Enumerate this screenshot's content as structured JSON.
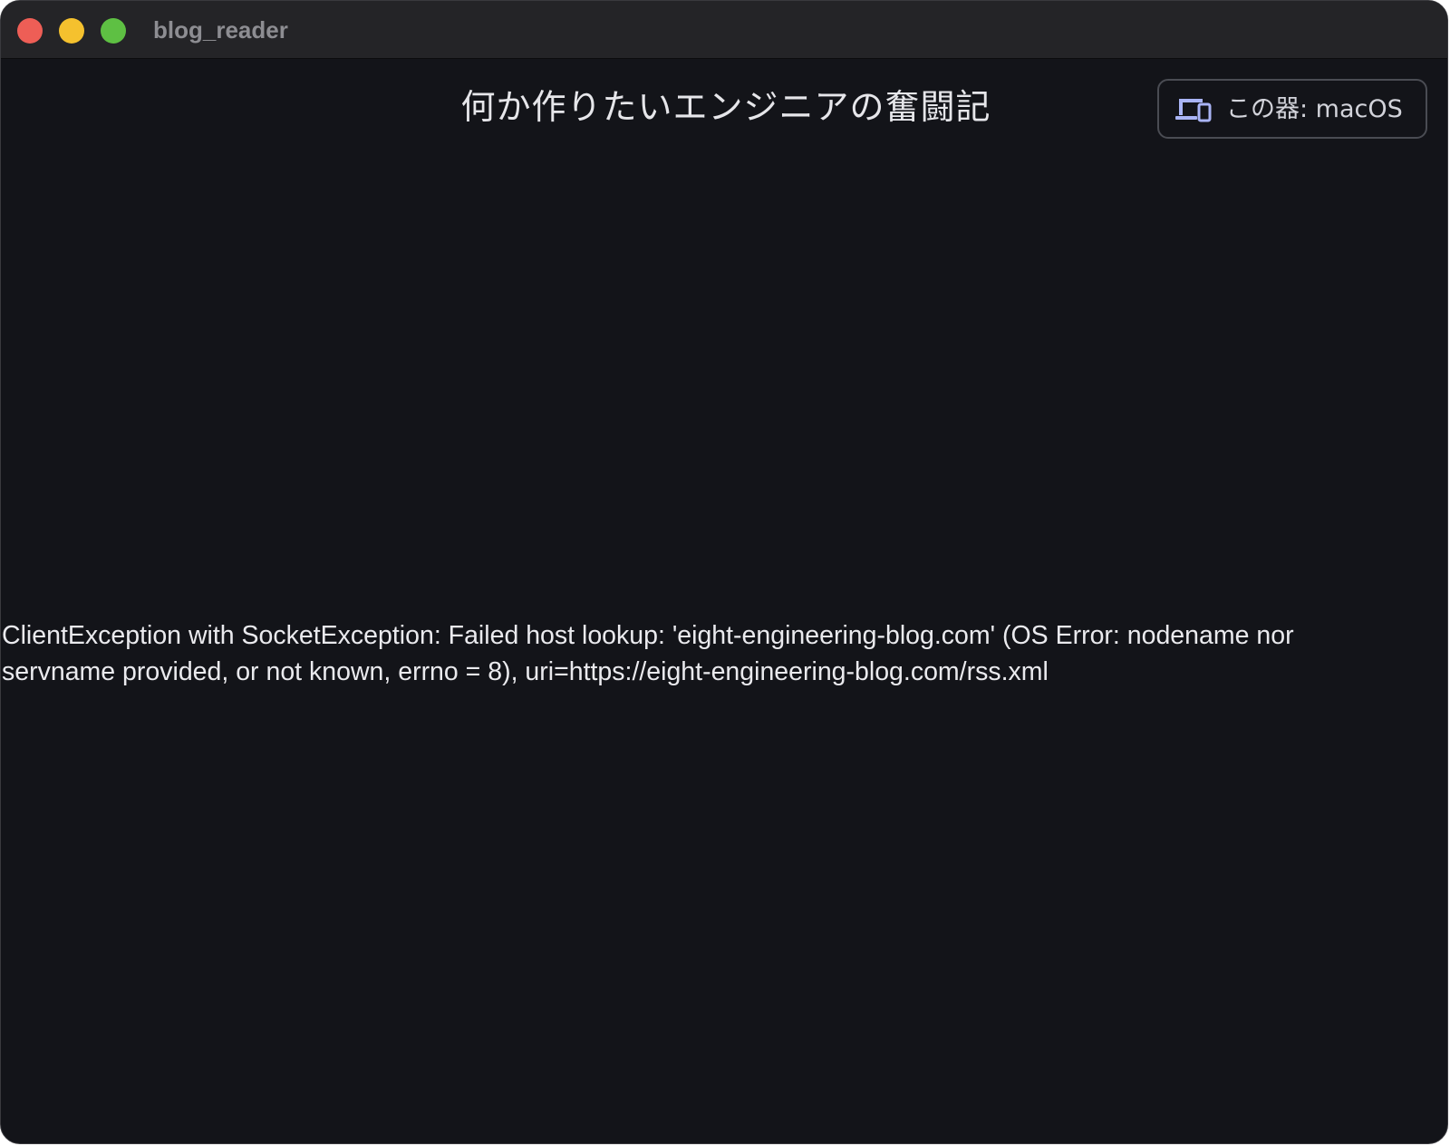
{
  "window": {
    "title": "blog_reader",
    "traffic_lights": {
      "close_color": "#ee5e56",
      "minimize_color": "#f5c12e",
      "zoom_color": "#5ec043"
    }
  },
  "header": {
    "title": "何か作りたいエンジニアの奮闘記",
    "platform_button": {
      "icon": "devices-icon",
      "label": "この器: macOS"
    }
  },
  "main": {
    "error_line_1": "ClientException with SocketException: Failed host lookup: 'eight-engineering-blog.com' (OS Error: nodename nor",
    "error_line_2": "servname provided, or not known, errno = 8), uri=https://eight-engineering-blog.com/rss.xml"
  },
  "colors": {
    "background": "#131419",
    "titlebar": "#242427",
    "accent_icon": "#a9b4f5"
  }
}
